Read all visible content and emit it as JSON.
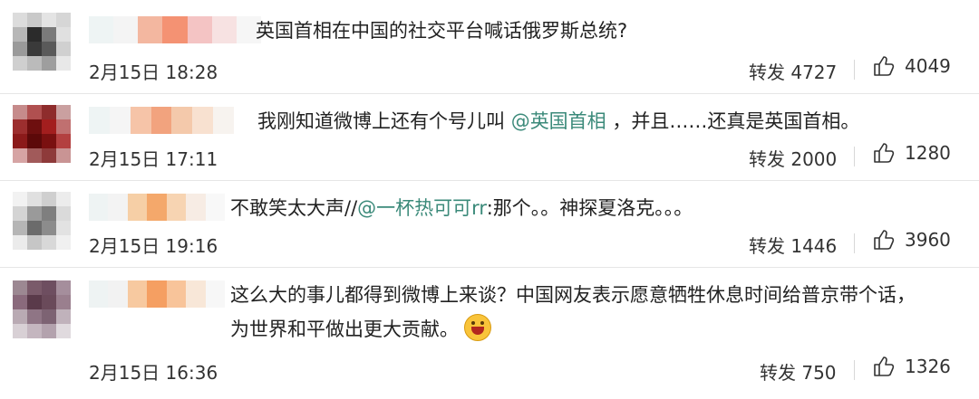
{
  "comments": [
    {
      "text_before": "英国首相在中国的社交平台喊话俄罗斯总统?",
      "mention": "",
      "text_after": "",
      "date": "2月15日 18:28",
      "repost_label": "转发",
      "repost_count": "4727",
      "like_count": "4049",
      "avatar_colors": [
        "#dcdcdc",
        "#c9c9c9",
        "#e4e4e4",
        "#d6d6d6",
        "#b7b7b7",
        "#2b2b2b",
        "#7a7a7a",
        "#e0e0e0",
        "#9a9a9a",
        "#3a3a3a",
        "#5a5a5a",
        "#d0d0d0",
        "#cfcfcf",
        "#bbbbbb",
        "#9e9e9e",
        "#e8e8e8"
      ],
      "name_colors": [
        "#eef4f4",
        "#f4f4f4",
        "#f3b7a0",
        "#f49273",
        "#f4c4c4",
        "#f7e2e2",
        "#f6f6f6"
      ]
    },
    {
      "text_before": "我刚知道微博上还有个号儿叫 ",
      "mention": "@英国首相",
      "text_after": " ，并且……还真是英国首相。",
      "date": "2月15日 17:11",
      "repost_label": "转发",
      "repost_count": "2000",
      "like_count": "1280",
      "avatar_colors": [
        "#c68b8b",
        "#b05050",
        "#8e2c2c",
        "#caa0a0",
        "#9c2e2e",
        "#6e0f0f",
        "#a31e1e",
        "#c07070",
        "#8b1a1a",
        "#5c0909",
        "#7a1010",
        "#b34040",
        "#d6a4a4",
        "#a15a5a",
        "#8e3a3a",
        "#c99494"
      ],
      "name_colors": [
        "#eef4f4",
        "#f5f5f5",
        "#f6c4a8",
        "#f2a37e",
        "#f4c9ab",
        "#f8e1d0",
        "#f7f3ef"
      ]
    },
    {
      "text_before": "不敢笑太大声//",
      "mention": "@一杯热可可rr",
      "text_after": ":那个。。神探夏洛克。。。",
      "date": "2月15日 19:16",
      "repost_label": "转发",
      "repost_count": "1446",
      "like_count": "3960",
      "avatar_colors": [
        "#f2f2f2",
        "#e0e0e0",
        "#cfcfcf",
        "#ececec",
        "#d4d4d4",
        "#9a9a9a",
        "#7f7f7f",
        "#dadada",
        "#b5b5b5",
        "#6b6b6b",
        "#8c8c8c",
        "#e2e2e2",
        "#ebebeb",
        "#c6c6c6",
        "#d8d8d8",
        "#f0f0f0"
      ],
      "name_colors": [
        "#eef3f3",
        "#f3f3f3",
        "#f6cfa6",
        "#f4a86b",
        "#f7d4b2",
        "#f7ece4",
        "#f8f8f8"
      ]
    },
    {
      "text_before": "这么大的事儿都得到微博上来谈？中国网友表示愿意牺牲休息时间给普京带个话，",
      "line2": "为世界和平做出更大贡献。",
      "mention": "",
      "text_after": "",
      "date": "2月15日 16:36",
      "repost_label": "转发",
      "repost_count": "750",
      "like_count": "1326",
      "avatar_colors": [
        "#9c8892",
        "#7a5a6a",
        "#6e4e60",
        "#a58e9c",
        "#8a6a7c",
        "#5a3a4a",
        "#6a4a5a",
        "#9a7f8e",
        "#b9aab3",
        "#8f7585",
        "#7d6373",
        "#c0b2bb",
        "#d8d0d5",
        "#c4b6bf",
        "#b3a2ad",
        "#e0dade"
      ],
      "name_colors": [
        "#eef3f3",
        "#f2f2f2",
        "#f7c9a0",
        "#f59f62",
        "#f8c49a",
        "#f8e7d8",
        "#f7f7f7"
      ]
    }
  ],
  "colors": {
    "mention": "#3b8a7a",
    "text": "#222222",
    "meta": "#333333",
    "divider": "#e6e6e6"
  },
  "icons": {
    "like": "thumbs-up-icon",
    "emoji": "grin-emoji-icon"
  }
}
